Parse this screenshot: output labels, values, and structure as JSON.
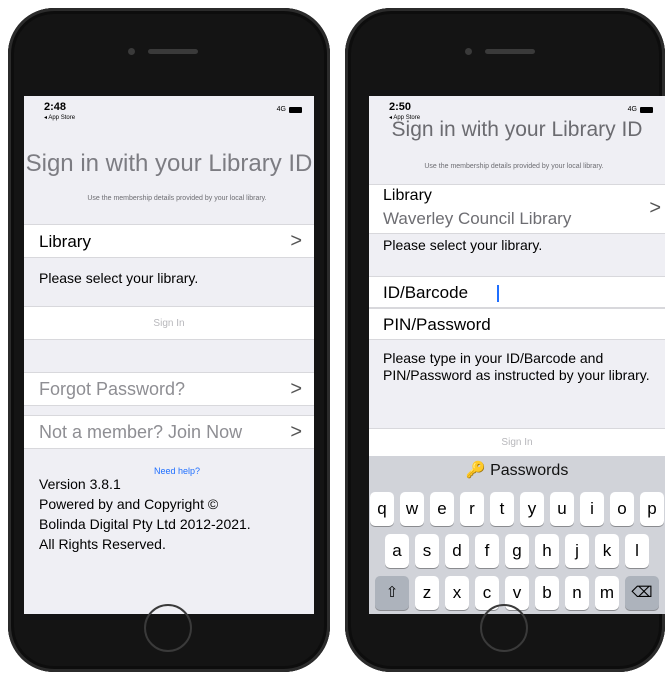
{
  "left": {
    "status": {
      "time": "2:48",
      "back": "◂ App Store",
      "signal": "4G"
    },
    "title": "Sign in with your Library ID",
    "hint": "Use the membership details provided by your local library.",
    "library_label": "Library",
    "library_prompt": "Please select your library.",
    "signin": "Sign In",
    "forgot": "Forgot Password?",
    "join": "Not a member? Join Now",
    "need_help": "Need help?",
    "version": "Version 3.8.1",
    "copyright_1": "Powered by and Copyright ©",
    "copyright_2": "Bolinda Digital Pty Ltd 2012-2021.",
    "copyright_3": "All Rights Reserved."
  },
  "right": {
    "status": {
      "time": "2:50",
      "back": "◂ App Store",
      "signal": "4G"
    },
    "title": "Sign in with your Library ID",
    "hint": "Use the membership details provided by your local library.",
    "library_label": "Library",
    "library_value": "Waverley Council Library",
    "library_prompt": "Please select your library.",
    "id_label": "ID/Barcode",
    "pin_label": "PIN/Password",
    "instructions": "Please type in your ID/Barcode and PIN/Password as instructed by your library.",
    "signin": "Sign In",
    "passwords": "Passwords",
    "keys_row1": [
      "q",
      "w",
      "e",
      "r",
      "t",
      "y",
      "u",
      "i",
      "o",
      "p"
    ],
    "keys_row2": [
      "a",
      "s",
      "d",
      "f",
      "g",
      "h",
      "j",
      "k",
      "l"
    ],
    "keys_row3": [
      "z",
      "x",
      "c",
      "v",
      "b",
      "n",
      "m"
    ],
    "shift": "⇧",
    "backspace": "⌫"
  },
  "icons": {
    "chevron": "chevron-right-icon",
    "key": "key-icon"
  }
}
